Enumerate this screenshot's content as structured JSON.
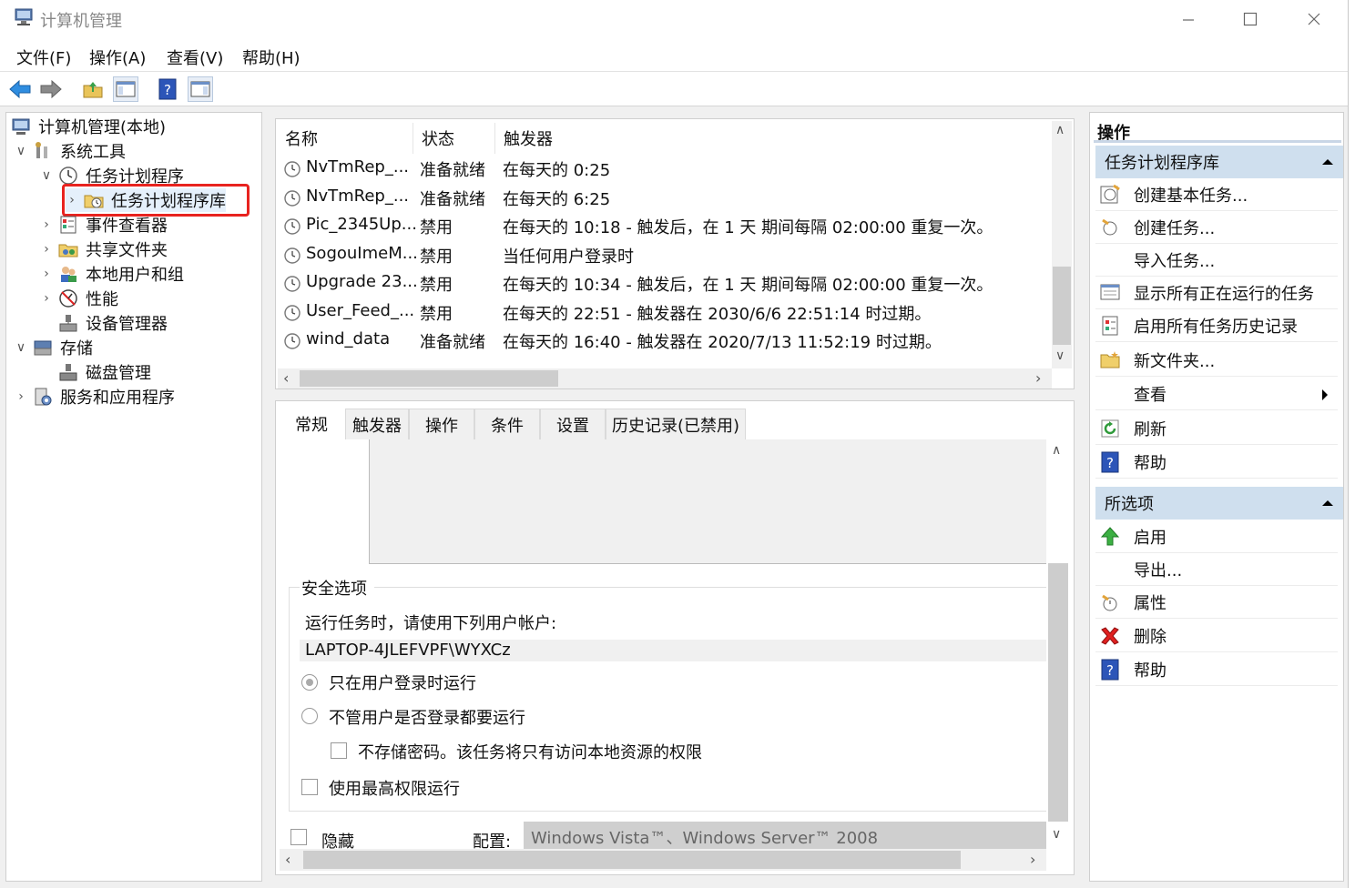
{
  "window": {
    "title": "计算机管理"
  },
  "menu": [
    "文件(F)",
    "操作(A)",
    "查看(V)",
    "帮助(H)"
  ],
  "tree": [
    {
      "label": "计算机管理(本地)",
      "icon": "computer-management-icon"
    },
    {
      "label": "系统工具",
      "icon": "system-tools-icon"
    },
    {
      "label": "任务计划程序",
      "icon": "task-scheduler-icon"
    },
    {
      "label": "任务计划程序库",
      "icon": "task-folder-icon"
    },
    {
      "label": "事件查看器",
      "icon": "event-viewer-icon"
    },
    {
      "label": "共享文件夹",
      "icon": "shared-folders-icon"
    },
    {
      "label": "本地用户和组",
      "icon": "users-groups-icon"
    },
    {
      "label": "性能",
      "icon": "performance-icon"
    },
    {
      "label": "设备管理器",
      "icon": "device-manager-icon"
    },
    {
      "label": "存储",
      "icon": "storage-icon"
    },
    {
      "label": "磁盘管理",
      "icon": "disk-management-icon"
    },
    {
      "label": "服务和应用程序",
      "icon": "services-apps-icon"
    }
  ],
  "table": {
    "headers": [
      "名称",
      "状态",
      "触发器"
    ],
    "rows": [
      {
        "name": "NvTmRep_...",
        "status": "准备就绪",
        "trigger": "在每天的 0:25"
      },
      {
        "name": "NvTmRep_...",
        "status": "准备就绪",
        "trigger": "在每天的 6:25"
      },
      {
        "name": "Pic_2345Up...",
        "status": "禁用",
        "trigger": "在每天的 10:18 - 触发后，在 1 天 期间每隔 02:00:00 重复一次。"
      },
      {
        "name": "SogouImeM...",
        "status": "禁用",
        "trigger": "当任何用户登录时"
      },
      {
        "name": "Upgrade 23...",
        "status": "禁用",
        "trigger": "在每天的 10:34 - 触发后，在 1 天 期间每隔 02:00:00 重复一次。"
      },
      {
        "name": "User_Feed_...",
        "status": "禁用",
        "trigger": "在每天的 22:51 - 触发器在 2030/6/6 22:51:14 时过期。"
      },
      {
        "name": "wind_data",
        "status": "准备就绪",
        "trigger": "在每天的 16:40 - 触发器在 2020/7/13 11:52:19 时过期。"
      }
    ]
  },
  "tabs": [
    "常规",
    "触发器",
    "操作",
    "条件",
    "设置",
    "历史记录(已禁用)"
  ],
  "general": {
    "security_title": "安全选项",
    "run_as_label": "运行任务时，请使用下列用户帐户:",
    "account": "LAPTOP-4JLEFVPF\\WYXCz",
    "radio1": "只在用户登录时运行",
    "radio2": "不管用户是否登录都要运行",
    "no_store_password": "不存储密码。该任务将只有访问本地资源的权限",
    "highest": "使用最高权限运行",
    "hidden": "隐藏",
    "config_label": "配置:",
    "config_value": "Windows Vista™、Windows Server™ 2008"
  },
  "actions": {
    "title": "操作",
    "section1": "任务计划程序库",
    "items1": [
      "创建基本任务...",
      "创建任务...",
      "导入任务...",
      "显示所有正在运行的任务",
      "启用所有任务历史记录",
      "新文件夹...",
      "查看",
      "刷新",
      "帮助"
    ],
    "section2": "所选项",
    "items2": [
      "启用",
      "导出...",
      "属性",
      "删除",
      "帮助"
    ]
  }
}
